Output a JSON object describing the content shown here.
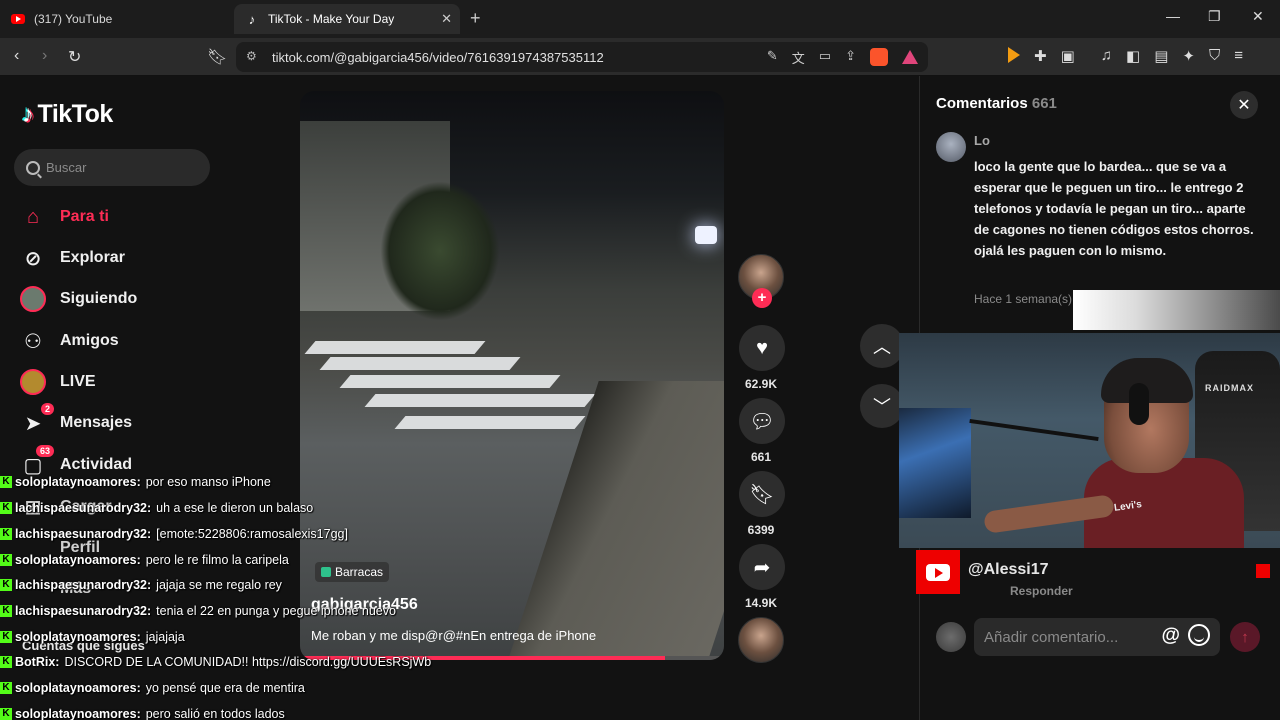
{
  "browser": {
    "tabs": [
      {
        "label": "(317) YouTube",
        "icon": "youtube-icon"
      },
      {
        "label": "TikTok - Make Your Day",
        "icon": "tiktok-icon"
      }
    ],
    "url": "tiktok.com/@gabigarcia456/video/7616391974387535112"
  },
  "sidebar": {
    "logo": "TikTok",
    "search_placeholder": "Buscar",
    "items": [
      {
        "label": "Para ti",
        "icon": "home-icon"
      },
      {
        "label": "Explorar",
        "icon": "compass-icon"
      },
      {
        "label": "Siguiendo",
        "icon": "following-avatar-icon"
      },
      {
        "label": "Amigos",
        "icon": "friends-icon"
      },
      {
        "label": "LIVE",
        "icon": "live-icon"
      },
      {
        "label": "Mensajes",
        "icon": "messages-icon",
        "badge": "2"
      },
      {
        "label": "Actividad",
        "icon": "activity-icon",
        "badge": "63"
      },
      {
        "label": "Cargar",
        "icon": "upload-icon"
      },
      {
        "label": "Perfil",
        "icon": "profile-icon"
      },
      {
        "label": "Más",
        "icon": "more-icon"
      }
    ],
    "following_heading": "Cuentas que sigues"
  },
  "video": {
    "location": "Barracas",
    "author": "gabigarcia456",
    "caption": "Me roban y me disp@r@#nEn entrega de iPhone",
    "progress_fraction": 0.86
  },
  "actions": {
    "likes": "62.9K",
    "comments": "661",
    "saves": "6399",
    "shares": "14.9K"
  },
  "comments_panel": {
    "title": "Comentarios",
    "count": "661",
    "comment": {
      "user": "Lo",
      "text": "loco la gente que lo bardea... que se va a esperar que le peguen un tiro... le entrego 2 telefonos y todavía le pegan un tiro... aparte de cagones no tienen códigos estos chorros. ojalá les paguen con lo mismo.",
      "time": "Hace 1 semana(s)"
    },
    "reply_label": "Responder",
    "input_placeholder": "Añadir comentario..."
  },
  "stream_overlay": {
    "youtube_handle": "@Alessi17",
    "chair_brand": "RAIDMAX",
    "shirt_brand": "Levi's",
    "chat": [
      {
        "user": "soloplataynoamores:",
        "msg": "por eso manso iPhone"
      },
      {
        "user": "lachispaesunarodry32:",
        "msg": "uh a ese le dieron un balaso"
      },
      {
        "user": "lachispaesunarodry32:",
        "msg": "[emote:5228806:ramosalexis17gg]"
      },
      {
        "user": "soloplataynoamores:",
        "msg": "pero le re filmo la caripela"
      },
      {
        "user": "lachispaesunarodry32:",
        "msg": "jajaja se me regalo rey"
      },
      {
        "user": "lachispaesunarodry32:",
        "msg": "tenia el 22 en punga y pegue iphone nuevo"
      },
      {
        "user": "soloplataynoamores:",
        "msg": "jajajaja"
      },
      {
        "user": "BotRix:",
        "msg": "DISCORD DE LA COMUNIDAD!! https://discord.gg/UUUEsRSjWb"
      },
      {
        "user": "soloplataynoamores:",
        "msg": "yo pensé que era de mentira"
      },
      {
        "user": "soloplataynoamores:",
        "msg": "pero salió en todos lados"
      }
    ]
  }
}
